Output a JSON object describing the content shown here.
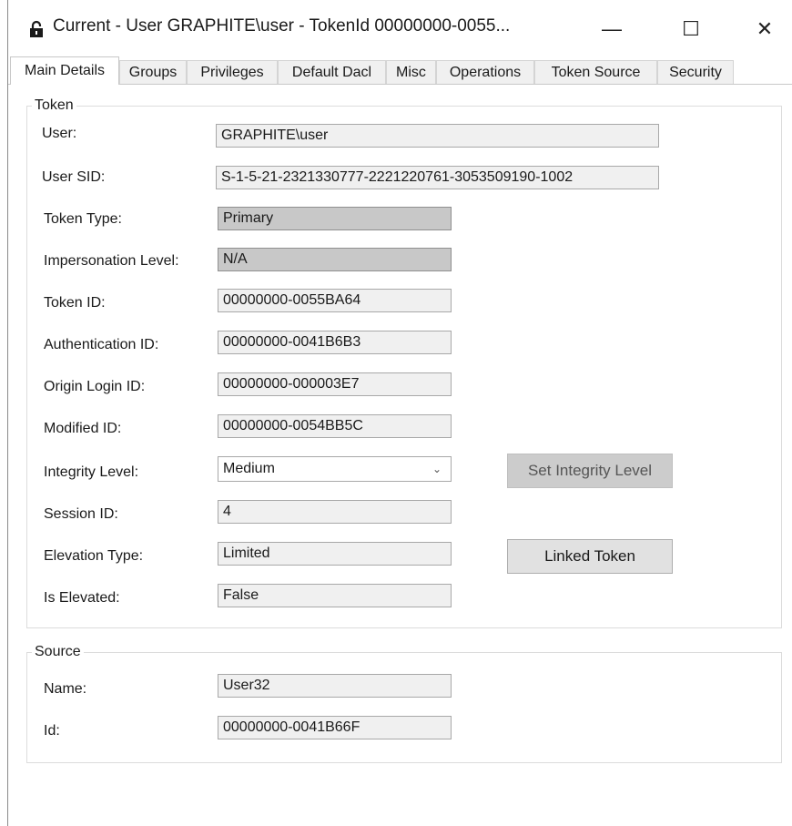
{
  "window": {
    "title": "Current - User GRAPHITE\\user - TokenId 00000000-0055...",
    "minimize_glyph": "—",
    "maximize_glyph": "☐",
    "close_glyph": "✕",
    "title_icon": "lock-icon"
  },
  "tabs": [
    {
      "label": "Main Details",
      "active": true
    },
    {
      "label": "Groups"
    },
    {
      "label": "Privileges"
    },
    {
      "label": "Default Dacl"
    },
    {
      "label": "Misc"
    },
    {
      "label": "Operations"
    },
    {
      "label": "Token Source"
    },
    {
      "label": "Security"
    }
  ],
  "token_group": {
    "legend": "Token",
    "user": {
      "label": "User:",
      "value": "GRAPHITE\\user"
    },
    "user_sid": {
      "label": "User SID:",
      "value": "S-1-5-21-2321330777-2221220761-3053509190-1002"
    },
    "token_type": {
      "label": "Token Type:",
      "value": "Primary"
    },
    "impersonation_level": {
      "label": "Impersonation Level:",
      "value": "N/A"
    },
    "token_id": {
      "label": "Token ID:",
      "value": "00000000-0055BA64"
    },
    "authentication_id": {
      "label": "Authentication ID:",
      "value": "00000000-0041B6B3"
    },
    "origin_login_id": {
      "label": "Origin Login ID:",
      "value": "00000000-000003E7"
    },
    "modified_id": {
      "label": "Modified ID:",
      "value": "00000000-0054BB5C"
    },
    "integrity_level": {
      "label": "Integrity Level:",
      "value": "Medium",
      "chevron": "⌄"
    },
    "set_integrity_button": "Set Integrity Level",
    "session_id": {
      "label": "Session ID:",
      "value": "4"
    },
    "elevation_type": {
      "label": "Elevation Type:",
      "value": "Limited"
    },
    "linked_token_button": "Linked Token",
    "is_elevated": {
      "label": "Is Elevated:",
      "value": "False"
    }
  },
  "source_group": {
    "legend": "Source",
    "name": {
      "label": "Name:",
      "value": "User32"
    },
    "id": {
      "label": "Id:",
      "value": "00000000-0041B66F"
    }
  }
}
